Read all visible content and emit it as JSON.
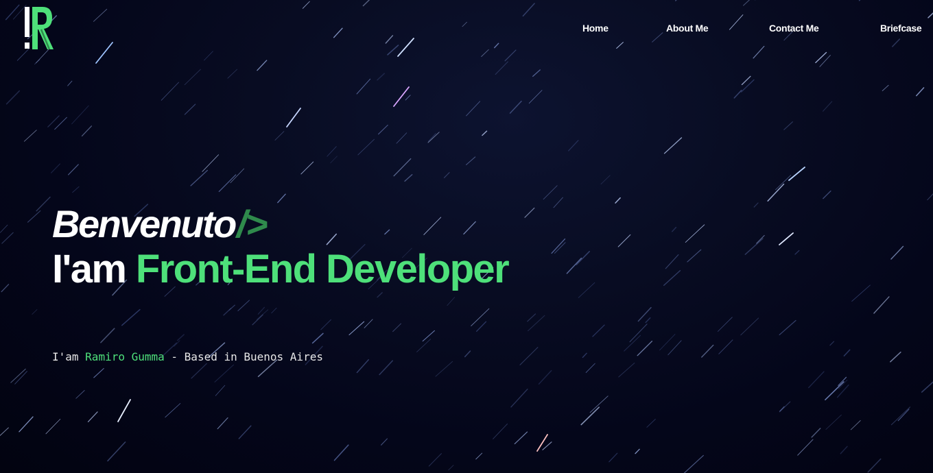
{
  "brand": {
    "logo_letter": "R",
    "accent_color": "#4ee07a",
    "dark_accent_color": "#2f8a4c",
    "background_color": "#05071a"
  },
  "nav": {
    "items": [
      {
        "label": "Home"
      },
      {
        "label": "About Me"
      },
      {
        "label": "Contact Me"
      },
      {
        "label": "Briefcase"
      }
    ]
  },
  "hero": {
    "greeting": "Benvenuto",
    "greeting_tag": "/>",
    "title_prefix": "I'am",
    "title_role": "Front-End Developer",
    "sub_prefix": "I'am",
    "sub_name": "Ramiro Gumma",
    "sub_suffix": "- Based in Buenos Aires"
  }
}
